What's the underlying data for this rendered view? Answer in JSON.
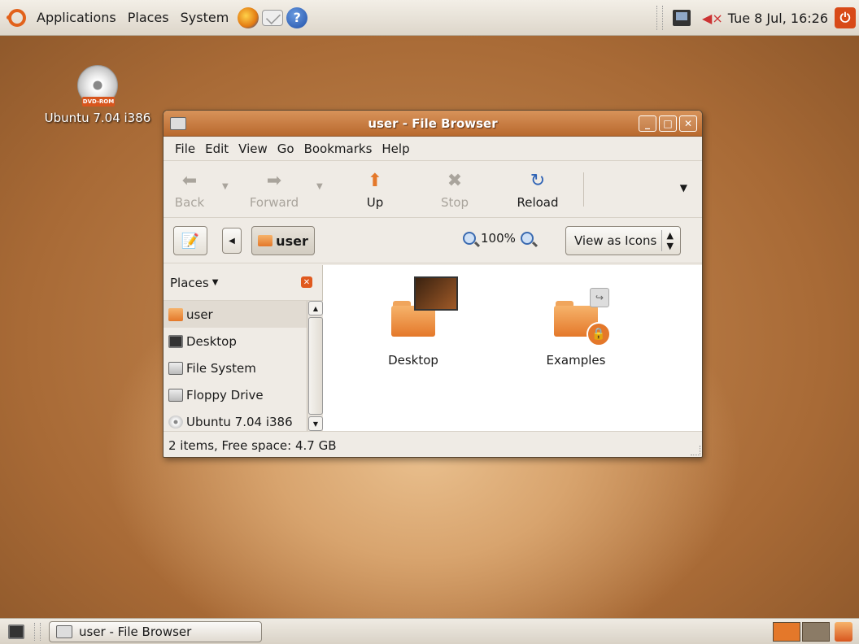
{
  "top_panel": {
    "menus": [
      "Applications",
      "Places",
      "System"
    ],
    "clock": "Tue  8 Jul, 16:26"
  },
  "desktop": {
    "dvd_badge": "DVD-ROM",
    "dvd_label": "Ubuntu 7.04 i386"
  },
  "window": {
    "title": "user - File Browser",
    "menubar": [
      "File",
      "Edit",
      "View",
      "Go",
      "Bookmarks",
      "Help"
    ],
    "toolbar": {
      "back": "Back",
      "forward": "Forward",
      "up": "Up",
      "stop": "Stop",
      "reload": "Reload"
    },
    "location": {
      "crumb": "user",
      "zoom": "100%",
      "view_mode": "View as Icons"
    },
    "sidepane": {
      "header": "Places",
      "items": [
        "user",
        "Desktop",
        "File System",
        "Floppy Drive",
        "Ubuntu 7.04 i386"
      ]
    },
    "files": [
      "Desktop",
      "Examples"
    ],
    "status": "2 items, Free space: 4.7 GB"
  },
  "bottom_panel": {
    "task": "user - File Browser"
  }
}
